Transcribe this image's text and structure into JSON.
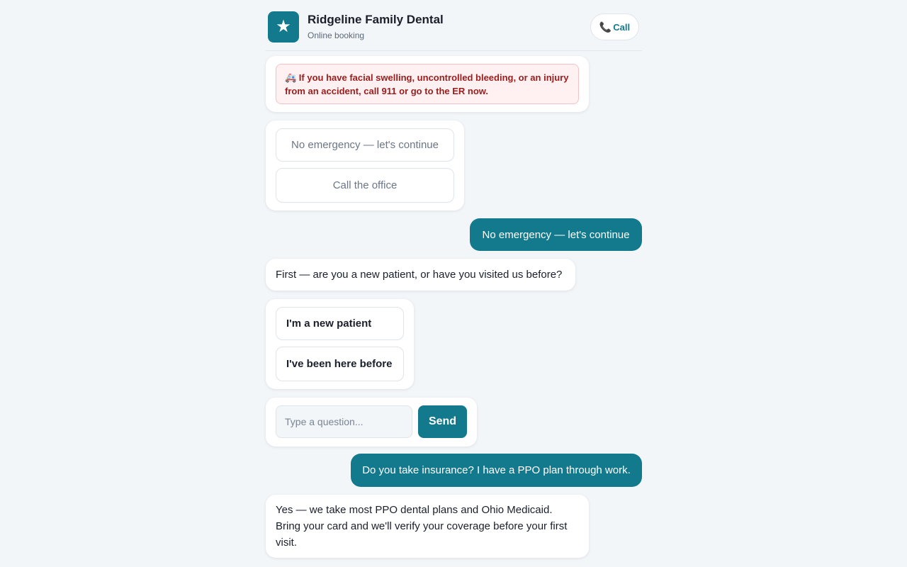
{
  "header": {
    "clinic_name": "Ridgeline Family Dental",
    "subtitle": "Online booking",
    "call_label": "Call",
    "logo_icon": "star-icon",
    "brand_color": "#137a8e"
  },
  "messages": {
    "emergency_alert": "🚑 If you have facial swelling, uncontrolled bleeding, or an injury from an accident, call 911 or go to the ER now.",
    "emergency_options": [
      "No emergency — let's continue",
      "Call the office"
    ],
    "user_reply_1": "No emergency — let's continue",
    "bot_question": "First — are you a new patient, or have you visited us before?",
    "patient_options": [
      "I'm a new patient",
      "I've been here before"
    ],
    "user_reply_2": "Do you take insurance? I have a PPO plan through work.",
    "bot_answer": "Yes — we take most PPO dental plans and Ohio Medicaid. Bring your card and we'll verify your coverage before your first visit."
  },
  "composer": {
    "placeholder": "Type a question...",
    "send_label": "Send"
  }
}
